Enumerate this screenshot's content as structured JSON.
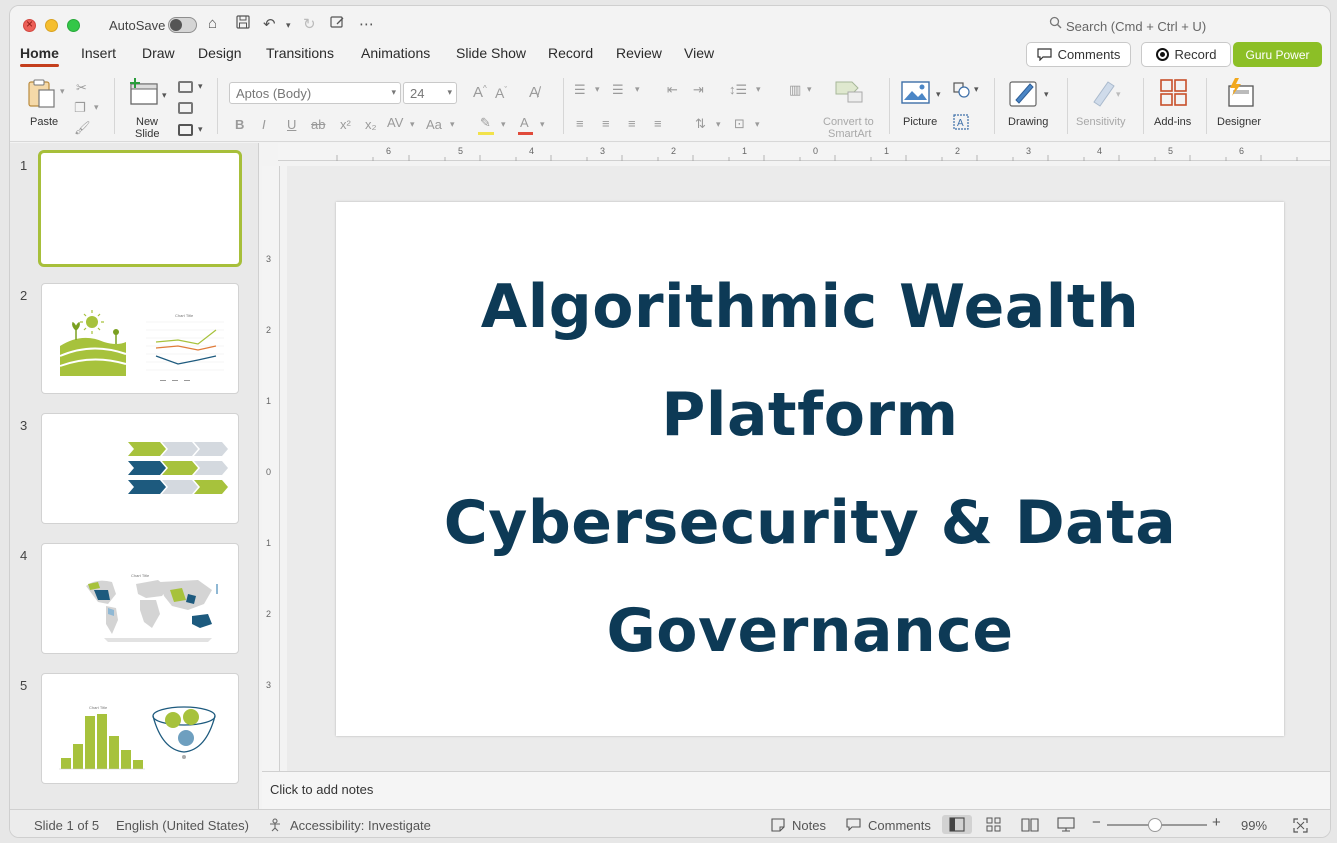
{
  "titlebar": {
    "autosave_label": "AutoSave",
    "search_placeholder": "Search (Cmd + Ctrl + U)"
  },
  "menu": {
    "tabs": [
      "Home",
      "Insert",
      "Draw",
      "Design",
      "Transitions",
      "Animations",
      "Slide Show",
      "Record",
      "Review",
      "View"
    ],
    "comments_label": "Comments",
    "record_label": "Record",
    "guru_label": "Guru Power"
  },
  "ribbon": {
    "paste_label": "Paste",
    "new_slide_label_1": "New",
    "new_slide_label_2": "Slide",
    "font_name": "Aptos (Body)",
    "font_size": "24",
    "convert_label_1": "Convert to",
    "convert_label_2": "SmartArt",
    "picture_label": "Picture",
    "drawing_label": "Drawing",
    "sensitivity_label": "Sensitivity",
    "addins_label": "Add-ins",
    "designer_label": "Designer"
  },
  "thumbnails": [
    {
      "number": "1"
    },
    {
      "number": "2",
      "chart_title": "Chart Title"
    },
    {
      "number": "3"
    },
    {
      "number": "4",
      "chart_title": "Chart Title"
    },
    {
      "number": "5",
      "chart_title": "Chart Title"
    }
  ],
  "slide": {
    "title_line_1": "Algorithmic Wealth",
    "title_line_2": "Platform",
    "title_line_3": "Cybersecurity & Data",
    "title_line_4": "Governance"
  },
  "notes_placeholder": "Click to add notes",
  "status": {
    "slide_count": "Slide 1 of 5",
    "language": "English (United States)",
    "accessibility": "Accessibility: Investigate",
    "notes_label": "Notes",
    "comments_label": "Comments",
    "zoom": "99%"
  },
  "ruler": {
    "top_numbers": [
      "6",
      "5",
      "4",
      "3",
      "2",
      "1",
      "0",
      "1",
      "2",
      "3",
      "4",
      "5",
      "6"
    ],
    "left_numbers": [
      "3",
      "2",
      "1",
      "0",
      "1",
      "2",
      "3"
    ]
  },
  "colors": {
    "accent_red": "#c43e1c",
    "guru_green": "#8cbf26",
    "title_navy": "#0d3a56",
    "thumb_green": "#a7c23c",
    "thumb_navy": "#1d5a7e"
  }
}
